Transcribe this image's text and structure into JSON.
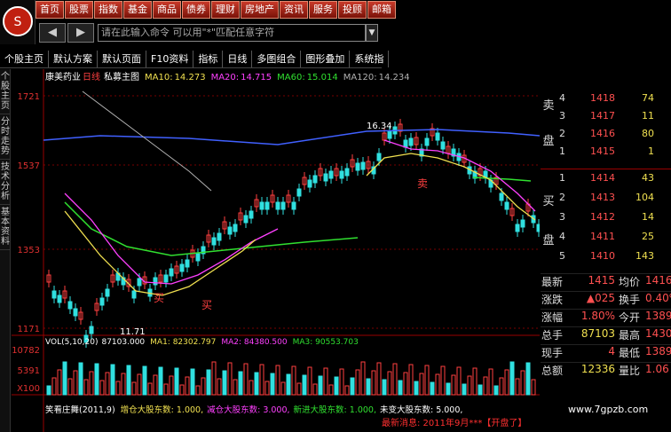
{
  "menu": {
    "items": [
      "首页",
      "股票",
      "指数",
      "基金",
      "商品",
      "债券",
      "理财",
      "房地产",
      "资讯",
      "服务",
      "投顾",
      "邮箱"
    ]
  },
  "toolbar": {
    "back": "◀",
    "forward": "▶",
    "command_placeholder": "请在此输入命令  可以用\"*\"匹配任意字符",
    "dropdown": "▼"
  },
  "tabs": {
    "items": [
      "个股主页",
      "默认方案",
      "默认页面",
      "F10资料",
      "指标",
      "日线",
      "多图组合",
      "图形叠加",
      "系统指"
    ]
  },
  "side_tabs": {
    "items": [
      "个股主页",
      "分时走势",
      "技术分析",
      "基本资料"
    ]
  },
  "chart": {
    "stock_name": "康美药业",
    "period": "日线",
    "indicator": "私募主图",
    "ma": [
      {
        "name": "MA10:",
        "value": "14.273",
        "color": "#f0e050"
      },
      {
        "name": "MA20:",
        "value": "14.715",
        "color": "#ff40ff"
      },
      {
        "name": "MA60:",
        "value": "15.014",
        "color": "#30e030"
      },
      {
        "name": "MA120:",
        "value": "14.234",
        "color": "#b0b0b0"
      }
    ],
    "y_labels": [
      "1721",
      "1537",
      "1353",
      "1171"
    ],
    "high_label": "16.34",
    "low_label": "11.71",
    "buy_label": "买",
    "sell_label": "卖",
    "vol_header": {
      "title": "VOL(5,10,20)",
      "value": "87103.000",
      "ma1": "MA1: 82302.797",
      "ma2": "MA2: 84380.500",
      "ma3": "MA3: 90553.703"
    },
    "vol_labels": [
      "10782",
      "5391",
      "X100"
    ],
    "bottom_text": {
      "name": "笑看庄舞(2011,9)",
      "a": "增仓大股东数: 1.000,",
      "b": "减仓大股东数: 3.000,",
      "c": "新进大股东数: 1.000,",
      "d": "未变大股东数: 5.000,"
    }
  },
  "orderbook": {
    "sell_label": "卖",
    "sell_side": "盘",
    "buy_label": "买",
    "buy_side": "盘",
    "asks": [
      {
        "level": "4",
        "price": "1418",
        "vol": "74"
      },
      {
        "level": "3",
        "price": "1417",
        "vol": "11"
      },
      {
        "level": "2",
        "price": "1416",
        "vol": "80"
      },
      {
        "level": "1",
        "price": "1415",
        "vol": "1"
      }
    ],
    "bids": [
      {
        "level": "1",
        "price": "1414",
        "vol": "43"
      },
      {
        "level": "2",
        "price": "1413",
        "vol": "104"
      },
      {
        "level": "3",
        "price": "1412",
        "vol": "14"
      },
      {
        "level": "4",
        "price": "1411",
        "vol": "25"
      },
      {
        "level": "5",
        "price": "1410",
        "vol": "143"
      }
    ]
  },
  "stats": {
    "rows": [
      {
        "l": "最新",
        "v": "1415",
        "l2": "均价",
        "v2": "1416"
      },
      {
        "l": "涨跌",
        "v": "▲025",
        "l2": "换手",
        "v2": "0.40%"
      },
      {
        "l": "涨幅",
        "v": "1.80%",
        "l2": "今开",
        "v2": "1389"
      },
      {
        "l": "总手",
        "v": "87103",
        "l2": "最高",
        "v2": "1430"
      },
      {
        "l": "现手",
        "v": "4",
        "l2": "最低",
        "v2": "1389"
      },
      {
        "l": "总额",
        "v": "12336",
        "l2": "量比",
        "v2": "1.06"
      }
    ]
  },
  "watermark": "www.7gpzb.com",
  "bottom_bar": "最新消息: 2011年9月***【开盘了】"
}
